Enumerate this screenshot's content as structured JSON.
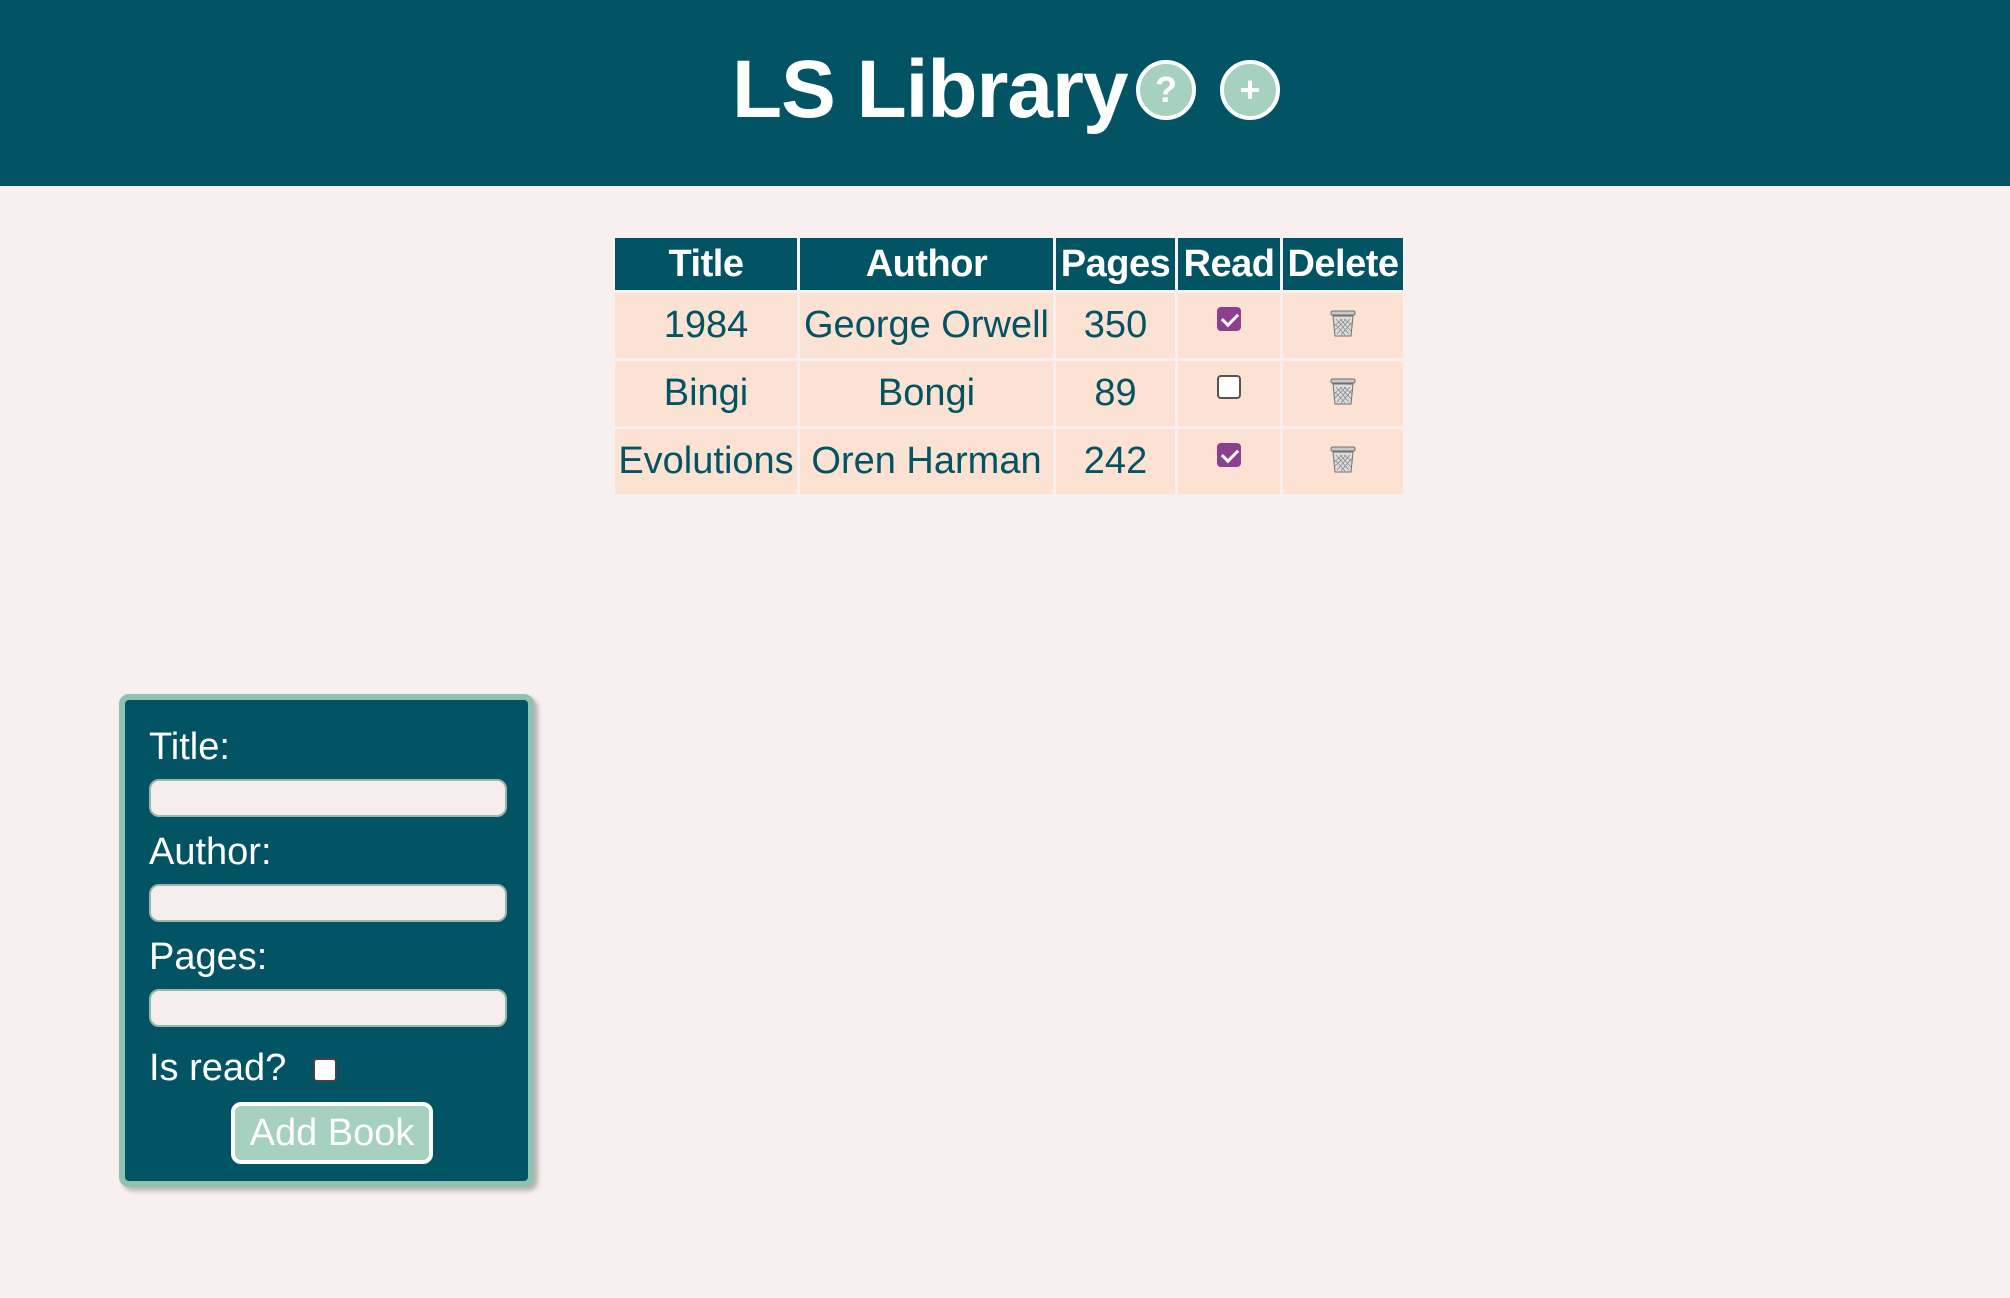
{
  "header": {
    "title": "LS Library",
    "help_icon": "question-mark-icon",
    "help_glyph": "?",
    "add_icon": "plus-icon",
    "add_glyph": "+",
    "background": "#025465"
  },
  "table": {
    "columns": [
      "Title",
      "Author",
      "Pages",
      "Read",
      "Delete"
    ],
    "rows": [
      {
        "title": "1984",
        "author": "George Orwell",
        "pages": "350",
        "read": true
      },
      {
        "title": "Bingi",
        "author": "Bongi",
        "pages": "89",
        "read": false
      },
      {
        "title": "Evolutions",
        "author": "Oren Harman",
        "pages": "242",
        "read": true
      }
    ],
    "delete_icon": "trash-icon",
    "row_background": "#fce2d3",
    "checkbox_color": "#8c3f8f"
  },
  "form": {
    "title_label": "Title:",
    "title_value": "",
    "author_label": "Author:",
    "author_value": "",
    "pages_label": "Pages:",
    "pages_value": "",
    "read_label": "Is read?",
    "read_checked": false,
    "submit_label": "Add Book",
    "accent": "#a6d0bf"
  }
}
